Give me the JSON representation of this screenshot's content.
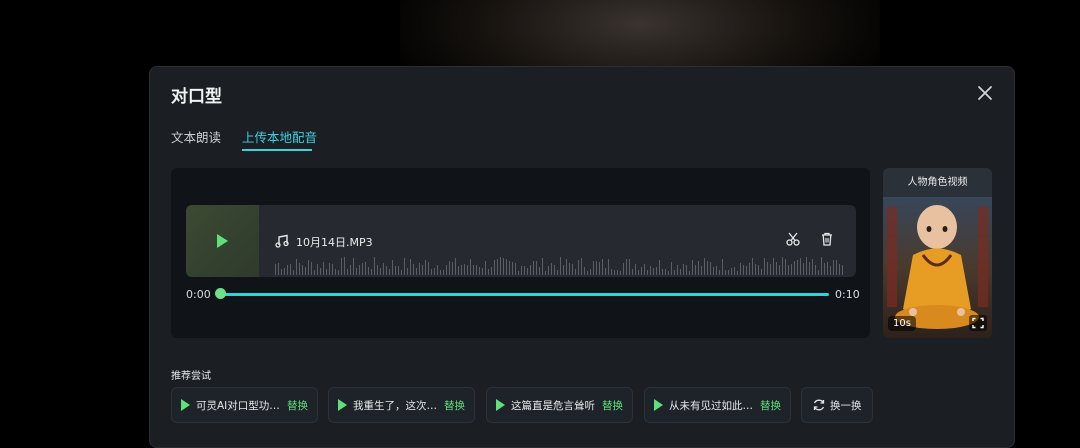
{
  "modal": {
    "title": "对口型",
    "close_icon": "close-icon"
  },
  "tabs": [
    {
      "label": "文本朗读",
      "active": false
    },
    {
      "label": "上传本地配音",
      "active": true
    }
  ],
  "player": {
    "file_name": "10月14日.MP3",
    "time_start": "0:00",
    "time_end": "0:10",
    "progress": 0,
    "icons": [
      "play-icon",
      "music-note-icon",
      "scissors-icon",
      "trash-icon"
    ]
  },
  "character": {
    "header": "人物角色视频",
    "duration_badge": "10s",
    "icons": [
      "fullscreen-icon"
    ]
  },
  "recommend": {
    "label": "推荐尝试",
    "items": [
      {
        "text": "可灵AI对口型功…",
        "action": "替换"
      },
      {
        "text": "我重生了，这次…",
        "action": "替换"
      },
      {
        "text": "这篇直是危言耸听",
        "action": "替换"
      },
      {
        "text": "从未有见过如此…",
        "action": "替换"
      }
    ],
    "refresh_label": "换一换"
  },
  "colors": {
    "accent_tab": "#38d3e0",
    "accent_green": "#5fe07a",
    "progress": "#2fd2d8"
  }
}
